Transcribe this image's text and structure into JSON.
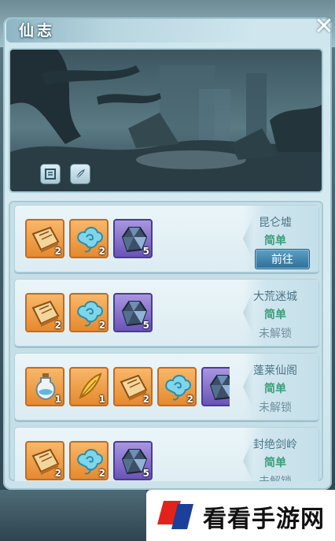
{
  "window": {
    "title": "仙志"
  },
  "controls": {
    "close_icon": "✕"
  },
  "scene": {
    "description_icons": [
      "scroll-icon",
      "feather-icon"
    ]
  },
  "levels": [
    {
      "name": "昆仑墟",
      "difficulty": "简单",
      "action": "前往",
      "unlocked": true,
      "rewards": [
        {
          "icon": "book-icon",
          "rarity": "orange",
          "count": "2"
        },
        {
          "icon": "cloud-spirit-icon",
          "rarity": "orange",
          "count": "2"
        },
        {
          "icon": "crystal-ore-icon",
          "rarity": "purple",
          "count": "5"
        }
      ]
    },
    {
      "name": "大荒迷城",
      "difficulty": "简单",
      "status": "未解锁",
      "unlocked": false,
      "rewards": [
        {
          "icon": "book-icon",
          "rarity": "orange",
          "count": "2"
        },
        {
          "icon": "cloud-spirit-icon",
          "rarity": "orange",
          "count": "2"
        },
        {
          "icon": "crystal-ore-icon",
          "rarity": "purple",
          "count": "5"
        }
      ]
    },
    {
      "name": "蓬莱仙阁",
      "difficulty": "简单",
      "status": "未解锁",
      "unlocked": false,
      "rewards": [
        {
          "icon": "potion-bottle-icon",
          "rarity": "orange",
          "count": "1"
        },
        {
          "icon": "golden-feather-icon",
          "rarity": "orange",
          "count": "1"
        },
        {
          "icon": "book-icon",
          "rarity": "orange",
          "count": "2"
        },
        {
          "icon": "cloud-spirit-icon",
          "rarity": "orange",
          "count": "2"
        },
        {
          "icon": "crystal-ore-icon",
          "rarity": "purple",
          "count": ""
        }
      ]
    },
    {
      "name": "封绝剑岭",
      "difficulty": "简单",
      "status": "未解锁",
      "unlocked": false,
      "rewards": [
        {
          "icon": "book-icon",
          "rarity": "orange",
          "count": "2"
        },
        {
          "icon": "cloud-spirit-icon",
          "rarity": "orange",
          "count": "2"
        },
        {
          "icon": "crystal-ore-icon",
          "rarity": "purple",
          "count": "5"
        }
      ]
    }
  ],
  "watermark": {
    "text": "看看手游网"
  },
  "colors": {
    "accent_blue": "#2f6f97",
    "difficulty_green": "#3a9e7a",
    "orange_rarity": "#e58a2f",
    "purple_rarity": "#6a54b8"
  }
}
